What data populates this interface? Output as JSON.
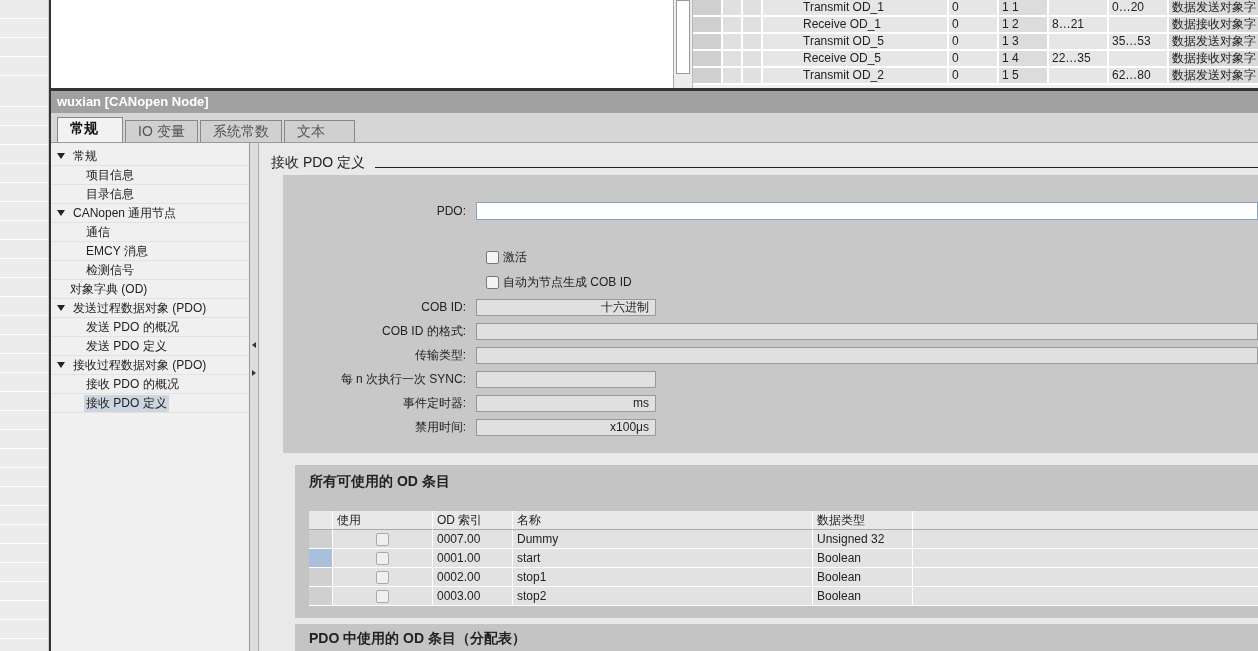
{
  "od_list": {
    "rows": [
      {
        "name": "Transmit OD_1",
        "col_2": "0",
        "col_3": "1 1",
        "col_5": "0…20",
        "col_6": "数据发送对象字"
      },
      {
        "name": "Receive OD_1",
        "col_2": "0",
        "col_3": "1 2",
        "col_4": "8…21",
        "col_6": "数据接收对象字"
      },
      {
        "name": "Transmit OD_5",
        "col_2": "0",
        "col_3": "1 3",
        "col_5": "35…53",
        "col_6": "数据发送对象字"
      },
      {
        "name": "Receive OD_5",
        "col_2": "0",
        "col_3": "1 4",
        "col_4": "22…35",
        "col_6": "数据接收对象字"
      },
      {
        "name": "Transmit OD_2",
        "col_2": "0",
        "col_3": "1 5",
        "col_5": "62…80",
        "col_6": "数据发送对象字"
      }
    ]
  },
  "editor": {
    "title": "wuxian [CANopen Node]",
    "tabs": [
      {
        "label": "常规",
        "selected": true
      },
      {
        "label": "IO 变量",
        "selected": false
      },
      {
        "label": "系统常数",
        "selected": false
      },
      {
        "label": "文本",
        "selected": false
      }
    ],
    "tree": [
      {
        "label": "常规",
        "expanded": true,
        "selected": false,
        "children": [
          {
            "label": "项目信息",
            "selected": false
          },
          {
            "label": "目录信息",
            "selected": false
          }
        ]
      },
      {
        "label": "CANopen 通用节点",
        "expanded": true,
        "selected": false,
        "children": [
          {
            "label": "通信",
            "selected": false
          },
          {
            "label": "EMCY 消息",
            "selected": false
          },
          {
            "label": "检测信号",
            "selected": false
          }
        ]
      },
      {
        "label": "对象字典 (OD)",
        "selected": false
      },
      {
        "label": "发送过程数据对象 (PDO)",
        "expanded": true,
        "selected": false,
        "children": [
          {
            "label": "发送 PDO 的概况",
            "selected": false
          },
          {
            "label": "发送 PDO 定义",
            "selected": false
          }
        ]
      },
      {
        "label": "接收过程数据对象 (PDO)",
        "expanded": true,
        "selected": false,
        "children": [
          {
            "label": "接收 PDO 的概况",
            "selected": false
          },
          {
            "label": "接收 PDO 定义",
            "selected": true
          }
        ]
      }
    ],
    "section_title": "接收 PDO 定义",
    "pdo_field": {
      "label": "PDO:"
    },
    "checkboxes": [
      {
        "label": "激活",
        "checked": false
      },
      {
        "label": "自动为节点生成 COB ID",
        "checked": false
      }
    ],
    "fields": [
      {
        "label": "COB ID:",
        "kind": "short",
        "value": "十六进制"
      },
      {
        "label": "COB ID 的格式:",
        "kind": "wide"
      },
      {
        "label": "传输类型:",
        "kind": "wide"
      },
      {
        "label": "每 n 次执行一次 SYNC:",
        "kind": "short"
      },
      {
        "label": "事件定时器:",
        "kind": "short",
        "value": "ms"
      },
      {
        "label": "禁用时间:",
        "kind": "short",
        "value": "x100μs"
      }
    ],
    "available": {
      "title": "所有可使用的 OD 条目",
      "columns": [
        "使用",
        "OD 索引",
        "名称",
        "数据类型"
      ],
      "rows": [
        {
          "used": false,
          "selected": false,
          "index": "0007.00",
          "name": "Dummy",
          "type": "Unsigned 32"
        },
        {
          "used": false,
          "selected": true,
          "index": "0001.00",
          "name": "start",
          "type": "Boolean"
        },
        {
          "used": false,
          "selected": false,
          "index": "0002.00",
          "name": "stop1",
          "type": "Boolean"
        },
        {
          "used": false,
          "selected": false,
          "index": "0003.00",
          "name": "stop2",
          "type": "Boolean"
        }
      ]
    },
    "mapping_title": "PDO 中使用的 OD 条目（分配表）"
  }
}
